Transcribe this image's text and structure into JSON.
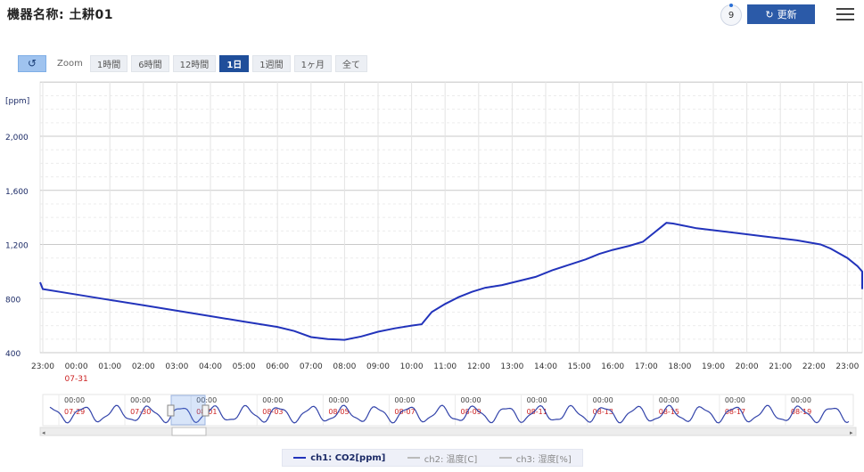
{
  "header": {
    "title": "機器名称: 土耕01",
    "counter": "9",
    "refresh_label": "更新"
  },
  "zoom": {
    "label": "Zoom",
    "buttons": [
      "1時間",
      "6時間",
      "12時間",
      "1日",
      "1週間",
      "1ヶ月",
      "全て"
    ],
    "active": "1日"
  },
  "chart_data": {
    "type": "line",
    "y_unit": "[ppm]",
    "ylim": [
      400,
      2000
    ],
    "y_ticks": [
      "2,000",
      "1,600",
      "1,200",
      "800",
      "400"
    ],
    "x_ticks": [
      "23:00",
      "00:00",
      "01:00",
      "02:00",
      "03:00",
      "04:00",
      "05:00",
      "06:00",
      "07:00",
      "08:00",
      "09:00",
      "10:00",
      "11:00",
      "12:00",
      "13:00",
      "14:00",
      "15:00",
      "16:00",
      "17:00",
      "18:00",
      "19:00",
      "20:00",
      "21:00",
      "22:00",
      "23:00"
    ],
    "x_date_label": "07-31",
    "grid": true,
    "series": [
      {
        "name": "ch1: CO2[ppm]",
        "color": "#2233bb",
        "points": [
          [
            -1.3,
            920
          ],
          [
            0,
            870
          ],
          [
            1,
            830
          ],
          [
            2,
            790
          ],
          [
            3,
            750
          ],
          [
            4,
            710
          ],
          [
            5,
            670
          ],
          [
            6,
            630
          ],
          [
            7,
            590
          ],
          [
            7.5,
            560
          ],
          [
            8,
            515
          ],
          [
            8.5,
            500
          ],
          [
            9,
            495
          ],
          [
            9.5,
            520
          ],
          [
            10,
            555
          ],
          [
            10.5,
            580
          ],
          [
            11,
            600
          ],
          [
            11.3,
            610
          ],
          [
            11.6,
            700
          ],
          [
            12,
            760
          ],
          [
            12.4,
            810
          ],
          [
            12.8,
            850
          ],
          [
            13.2,
            880
          ],
          [
            13.7,
            900
          ],
          [
            14.2,
            930
          ],
          [
            14.7,
            960
          ],
          [
            15.2,
            1010
          ],
          [
            15.7,
            1050
          ],
          [
            16.2,
            1090
          ],
          [
            16.6,
            1130
          ],
          [
            17,
            1160
          ],
          [
            17.5,
            1190
          ],
          [
            17.9,
            1220
          ],
          [
            18.2,
            1280
          ],
          [
            18.45,
            1330
          ],
          [
            18.6,
            1360
          ],
          [
            18.8,
            1355
          ],
          [
            19.5,
            1320
          ],
          [
            20.5,
            1290
          ],
          [
            21.5,
            1260
          ],
          [
            22.5,
            1230
          ],
          [
            23.2,
            1200
          ],
          [
            23.5,
            1170
          ],
          [
            24,
            1100
          ],
          [
            24.3,
            1040
          ],
          [
            25,
            1000
          ],
          [
            26,
            950
          ],
          [
            26.5,
            910
          ],
          [
            27.3,
            870
          ]
        ]
      }
    ]
  },
  "navigator": {
    "labels": [
      {
        "time": "00:00",
        "date": "07-29"
      },
      {
        "time": "00:00",
        "date": "07-30"
      },
      {
        "time": "00:00",
        "date": "08-01"
      },
      {
        "time": "00:00",
        "date": "08-03"
      },
      {
        "time": "00:00",
        "date": "08-05"
      },
      {
        "time": "00:00",
        "date": "08-07"
      },
      {
        "time": "00:00",
        "date": "08-09"
      },
      {
        "time": "00:00",
        "date": "08-11"
      },
      {
        "time": "00:00",
        "date": "08-13"
      },
      {
        "time": "00:00",
        "date": "08-15"
      },
      {
        "time": "00:00",
        "date": "08-17"
      },
      {
        "time": "00:00",
        "date": "08-19"
      }
    ]
  },
  "legend": [
    {
      "label": "ch1: CO2[ppm]",
      "active": true
    },
    {
      "label": "ch2: 温度[C]",
      "active": false
    },
    {
      "label": "ch3: 湿度[%]",
      "active": false
    }
  ]
}
